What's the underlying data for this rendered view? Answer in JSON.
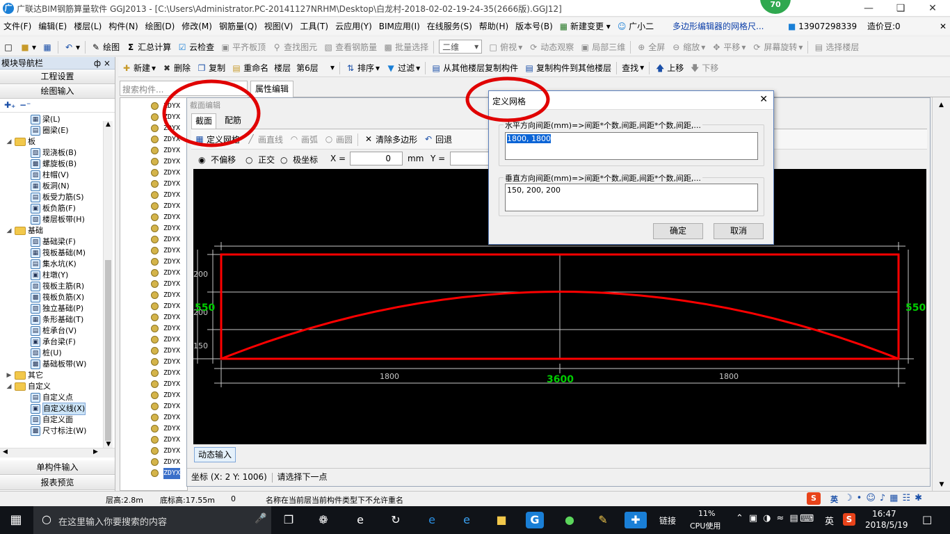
{
  "window": {
    "title": "广联达BIM钢筋算量软件 GGJ2013 - [C:\\Users\\Administrator.PC-20141127NRHM\\Desktop\\白龙村-2018-02-02-19-24-35(2666版).GGJ12]",
    "badge": "70",
    "icon_label": "广"
  },
  "menu": {
    "items": [
      "文件(F)",
      "编辑(E)",
      "楼层(L)",
      "构件(N)",
      "绘图(D)",
      "修改(M)",
      "钢筋量(Q)",
      "视图(V)",
      "工具(T)",
      "云应用(Y)",
      "BIM应用(I)",
      "在线服务(S)",
      "帮助(H)",
      "版本号(B)"
    ],
    "new_change": "新建变更",
    "assistant": "广小二",
    "notice": "多边形编辑器的网格尺...",
    "phone": "13907298339",
    "price_bean": "造价豆:0"
  },
  "toolbar1": {
    "draw": "绘图",
    "sum": "汇总计算",
    "cloud_check": "云检查",
    "flat_top": "平齐板顶",
    "find_elem": "查找图元",
    "view_rebar": "查看钢筋量",
    "batch_select": "批量选择",
    "view_mode": "二维",
    "top_view": "俯视",
    "dynamic": "动态观察",
    "local_3d": "局部三维",
    "fullscreen": "全屏",
    "zoom": "缩放",
    "pan": "平移",
    "rotate": "屏幕旋转",
    "select_floor": "选择楼层"
  },
  "toolbar2": {
    "new": "新建",
    "delete": "删除",
    "copy": "复制",
    "rename": "重命名",
    "floor_label": "楼层",
    "floor_value": "第6层",
    "sort": "排序",
    "filter": "过滤",
    "copy_from": "从其他楼层复制构件",
    "copy_to": "复制构件到其他楼层",
    "find": "查找",
    "move_up": "上移",
    "move_down": "下移"
  },
  "left_panel": {
    "title": "模块导航栏",
    "pin": "ф ×",
    "project_settings": "工程设置",
    "draw_input": "绘图输入",
    "single_input": "单构件输入",
    "report_preview": "报表预览",
    "tree": [
      {
        "label": "梁(L)",
        "level": 2
      },
      {
        "label": "圈梁(E)",
        "level": 2
      },
      {
        "label": "板",
        "level": 1
      },
      {
        "label": "现浇板(B)",
        "level": 2
      },
      {
        "label": "螺旋板(B)",
        "level": 2
      },
      {
        "label": "柱帽(V)",
        "level": 2
      },
      {
        "label": "板洞(N)",
        "level": 2
      },
      {
        "label": "板受力筋(S)",
        "level": 2
      },
      {
        "label": "板负筋(F)",
        "level": 2
      },
      {
        "label": "楼层板带(H)",
        "level": 2
      },
      {
        "label": "基础",
        "level": 1
      },
      {
        "label": "基础梁(F)",
        "level": 2
      },
      {
        "label": "筏板基础(M)",
        "level": 2
      },
      {
        "label": "集水坑(K)",
        "level": 2
      },
      {
        "label": "柱墩(Y)",
        "level": 2
      },
      {
        "label": "筏板主筋(R)",
        "level": 2
      },
      {
        "label": "筏板负筋(X)",
        "level": 2
      },
      {
        "label": "独立基础(P)",
        "level": 2
      },
      {
        "label": "条形基础(T)",
        "level": 2
      },
      {
        "label": "桩承台(V)",
        "level": 2
      },
      {
        "label": "承台梁(F)",
        "level": 2
      },
      {
        "label": "桩(U)",
        "level": 2
      },
      {
        "label": "基础板带(W)",
        "level": 2
      },
      {
        "label": "其它",
        "level": 1
      },
      {
        "label": "自定义",
        "level": 1
      },
      {
        "label": "自定义点",
        "level": 2
      },
      {
        "label": "自定义线(X)",
        "level": 2
      },
      {
        "label": "自定义面",
        "level": 2
      },
      {
        "label": "尺寸标注(W)",
        "level": 2
      }
    ]
  },
  "component_list": {
    "search_placeholder": "搜索构件...",
    "item_label": "ZDYX"
  },
  "property_tab": "属性编辑",
  "section_editor": {
    "title": "截面编辑",
    "tab_section": "截面",
    "tab_rebar": "配筋",
    "define_grid": "定义网格",
    "draw_line": "画直线",
    "draw_arc": "画弧",
    "draw_circle": "画圆",
    "clear_polygon": "清除多边形",
    "undo": "回退",
    "mode_no_offset": "不偏移",
    "mode_ortho": "正交",
    "mode_polar": "极坐标",
    "x_label": "X =",
    "x_value": "0",
    "unit": "mm",
    "y_label": "Y =",
    "dynamic_input": "动态输入",
    "coord": "坐标 (X: 2 Y: 1006)",
    "prompt": "请选择下一点"
  },
  "drawing": {
    "dim_top_left": "200",
    "dim_mid_left": "200",
    "dim_bot_left": "150",
    "total_height_left": "550",
    "total_height_right": "550",
    "dim_bottom_left": "1800",
    "dim_bottom_right": "1800",
    "total_width": "3600",
    "colors": {
      "outline": "#ff0000",
      "grid": "#c8c8c8",
      "total": "#00cc00"
    }
  },
  "dialog": {
    "title": "定义网格",
    "h_label": "水平方向间距(mm)=>间距*个数,间距,间距*个数,间距,...",
    "h_value": "1800, 1800",
    "v_label": "垂直方向间距(mm)=>间距*个数,间距,间距*个数,间距,...",
    "v_value": "150, 200, 200",
    "ok": "确定",
    "cancel": "取消"
  },
  "status": {
    "floor_height": "层高:2.8m",
    "bottom_elev": "底标高:17.55m",
    "zero": "0",
    "message": "名称在当前层当前构件类型下不允许重名"
  },
  "taskbar": {
    "search_placeholder": "在这里输入你要搜索的内容",
    "link": "链接",
    "cpu_percent": "11%",
    "cpu_label": "CPU使用",
    "ime": "英",
    "time": "16:47",
    "date": "2018/5/19"
  }
}
